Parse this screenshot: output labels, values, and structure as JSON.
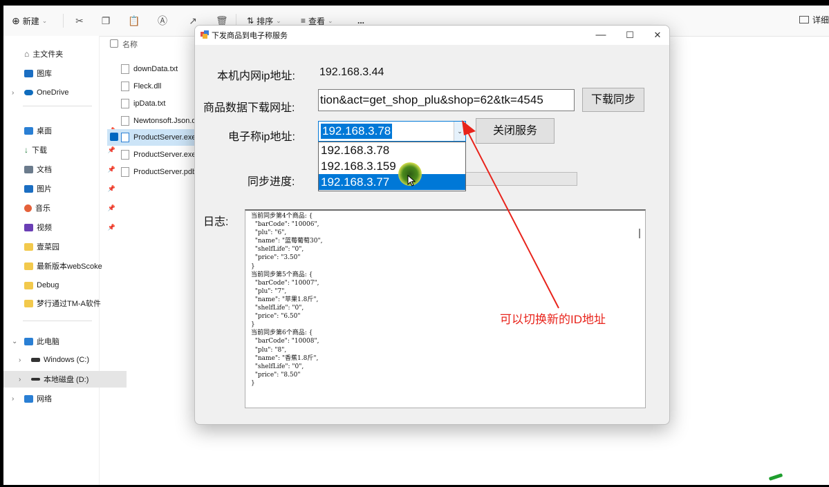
{
  "toolbar": {
    "new_label": "新建",
    "sort_label": "排序",
    "view_label": "查看",
    "more_label": "...",
    "details_label": "详细"
  },
  "nav": {
    "items": [
      {
        "label": "主文件夹"
      },
      {
        "label": "图库"
      },
      {
        "label": "OneDrive"
      },
      {
        "label": "桌面"
      },
      {
        "label": "下载"
      },
      {
        "label": "文档"
      },
      {
        "label": "图片"
      },
      {
        "label": "音乐"
      },
      {
        "label": "视频"
      },
      {
        "label": "壹菜园"
      },
      {
        "label": "最新版本webScoke"
      },
      {
        "label": "Debug"
      },
      {
        "label": "梦行通过TM-A软件"
      },
      {
        "label": "此电脑"
      },
      {
        "label": "Windows (C:)"
      },
      {
        "label": "本地磁盘 (D:)"
      },
      {
        "label": "网络"
      }
    ]
  },
  "files": {
    "header": "名称",
    "items": [
      {
        "name": "downData.txt"
      },
      {
        "name": "Fleck.dll"
      },
      {
        "name": "ipData.txt"
      },
      {
        "name": "Newtonsoft.Json.dll"
      },
      {
        "name": "ProductServer.exe"
      },
      {
        "name": "ProductServer.exe.config"
      },
      {
        "name": "ProductServer.pdb"
      }
    ]
  },
  "dialog": {
    "title": "下发商品到电子称服务",
    "minimize": "—",
    "maximize": "☐",
    "close": "✕",
    "local_ip_label": "本机内网ip地址:",
    "local_ip_value": "192.168.3.44",
    "url_label": "商品数据下载网址:",
    "url_value": "tion&act=get_shop_plu&shop=62&tk=4545",
    "sync_button": "下载同步",
    "scale_ip_label": "电子称ip地址:",
    "scale_ip_selected": "192.168.3.78",
    "close_service_button": "关闭服务",
    "options": [
      "192.168.3.78",
      "192.168.3.159",
      "192.168.3.77"
    ],
    "highlighted_option_index": 2,
    "progress_label": "同步进度:",
    "progress": 0,
    "log_label": "日志:",
    "log_text": "当前同步第4个商品: {\n  \"barCode\": \"10006\",\n  \"plu\": \"6\",\n  \"name\": \"蓝莓葡萄30\",\n  \"shelfLife\": \"0\",\n  \"price\": \"3.50\"\n}\n当前同步第5个商品: {\n  \"barCode\": \"10007\",\n  \"plu\": \"7\",\n  \"name\": \"苹果1.8斤\",\n  \"shelfLife\": \"0\",\n  \"price\": \"6.50\"\n}\n当前同步第6个商品: {\n  \"barCode\": \"10008\",\n  \"plu\": \"8\",\n  \"name\": \"香蕉1.8斤\",\n  \"shelfLife\": \"0\",\n  \"price\": \"8.50\"\n}"
  },
  "annotation": {
    "text": "可以切换新的ID地址",
    "color": "#e8241c"
  }
}
